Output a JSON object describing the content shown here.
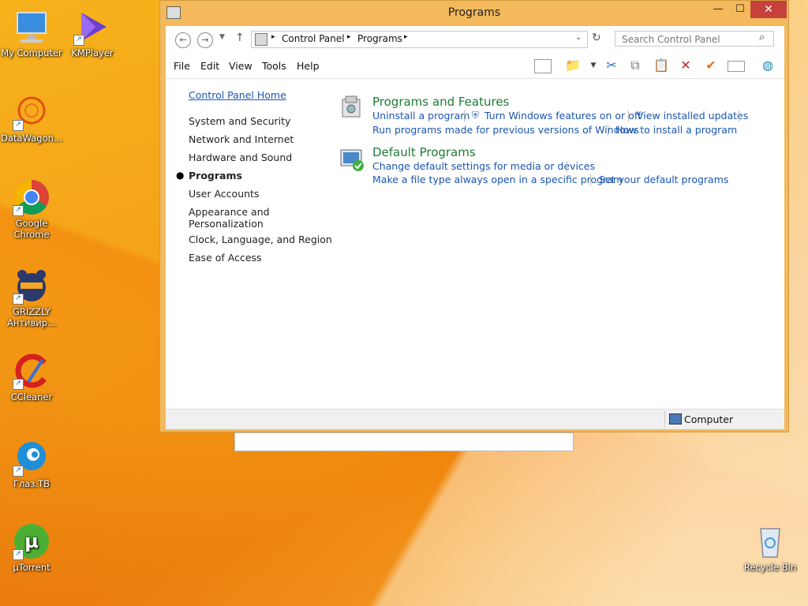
{
  "desktop": {
    "icons": [
      {
        "label": "My Computer"
      },
      {
        "label": "KMPlayer"
      },
      {
        "label": "DataWagon..."
      },
      {
        "label": "Google Chrome"
      },
      {
        "label": "GRIZZLY Антивир..."
      },
      {
        "label": "CCleaner"
      },
      {
        "label": "Глаз.ТВ"
      },
      {
        "label": "µTorrent"
      },
      {
        "label": "Recycle Bin"
      }
    ]
  },
  "window": {
    "title": "Programs",
    "controls": {
      "minimize": "—",
      "maximize": "☐",
      "close": "✕"
    },
    "address": {
      "parts": [
        "Control Panel",
        "Programs"
      ],
      "separator": "▸"
    },
    "search_placeholder": "Search Control Panel",
    "menu": [
      "File",
      "Edit",
      "View",
      "Tools",
      "Help"
    ],
    "nav": {
      "home": "Control Panel Home",
      "items": [
        "System and Security",
        "Network and Internet",
        "Hardware and Sound",
        "Programs",
        "User Accounts",
        "Appearance and Personalization",
        "Clock, Language, and Region",
        "Ease of Access"
      ]
    },
    "sections": [
      {
        "title": "Programs and Features",
        "links": [
          "Uninstall a program",
          "Turn Windows features on or off",
          "View installed updates",
          "Run programs made for previous versions of Windows",
          "How to install a program"
        ]
      },
      {
        "title": "Default Programs",
        "links": [
          "Change default settings for media or devices",
          "Make a file type always open in a specific program",
          "Set your default programs"
        ]
      }
    ],
    "status": "Computer"
  },
  "colors": {
    "link": "#1a56b0",
    "section_title": "#1e7c34",
    "close_button": "#c7413b",
    "window_frame": "#f3b95c"
  }
}
